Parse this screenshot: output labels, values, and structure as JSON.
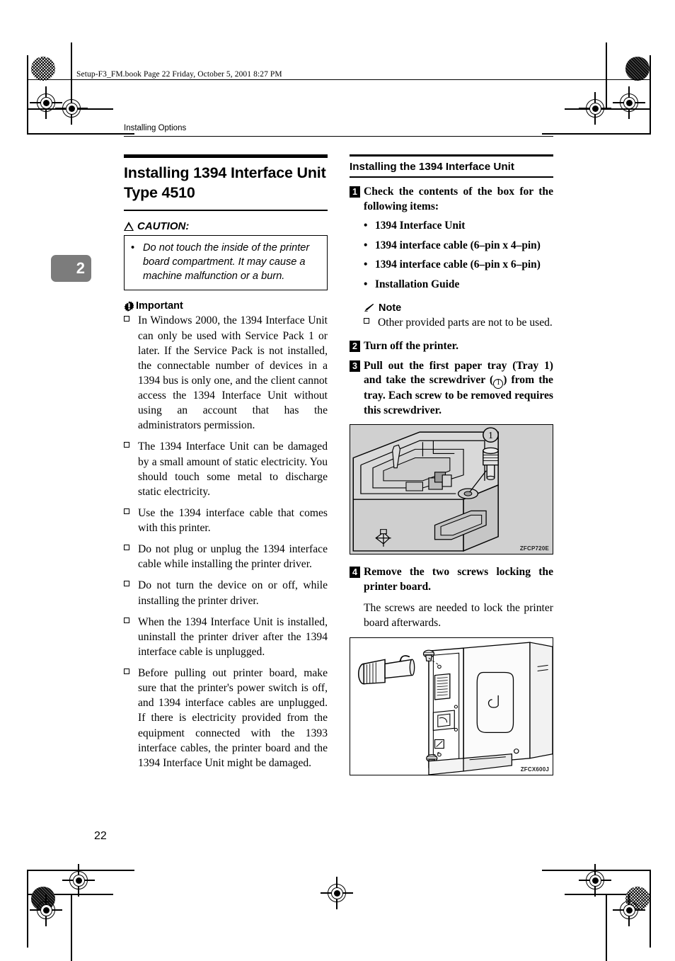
{
  "file_header": "Setup-F3_FM.book  Page 22  Friday, October 5, 2001  8:27 PM",
  "running_head": "Installing Options",
  "chapter_tab": "2",
  "page_number": "22",
  "left_column": {
    "title": "Installing 1394 Interface Unit Type 4510",
    "caution": {
      "label": "CAUTION:",
      "icon": "warning-triangle-icon",
      "items": [
        "Do not touch the inside of the printer board compartment. It may cause a machine malfunction or a burn."
      ]
    },
    "important": {
      "label": "Important",
      "icon": "important-starburst-icon",
      "items": [
        "In Windows 2000, the 1394 Interface Unit can only be used with Service Pack 1 or later. If the Service Pack is not installed, the connectable number of devices in a 1394 bus is only one, and the client cannot access the 1394 Interface Unit without using an account that has the administrators permission.",
        "The 1394 Interface Unit can be damaged by a small amount of static electricity. You should touch some metal to discharge static electricity.",
        "Use the 1394 interface cable that comes with this printer.",
        "Do not plug or unplug the 1394 interface cable while installing the printer driver.",
        "Do not turn the device on or off, while installing the printer driver.",
        "When the 1394 Interface Unit is installed, uninstall the printer driver after the 1394 interface cable is unplugged.",
        "Before pulling out printer board, make sure that the printer's power switch is off, and 1394 interface cables are unplugged. If there is electricity provided from the equipment connected with the 1393 interface cables, the printer board and the 1394 Interface Unit might be damaged."
      ]
    }
  },
  "right_column": {
    "section_title": "Installing the 1394 Interface Unit",
    "steps": [
      {
        "number": "1",
        "text": "Check the contents of the box for the following items:",
        "bullets": [
          "1394 Interface Unit",
          "1394 interface cable (6–pin x 4–pin)",
          "1394 interface cable (6–pin x 6–pin)",
          "Installation Guide"
        ],
        "note": {
          "label": "Note",
          "icon": "note-pencil-icon",
          "items": [
            "Other provided parts are not to be used."
          ]
        }
      },
      {
        "number": "2",
        "text": "Turn off the printer."
      },
      {
        "number": "3",
        "text_before": "Pull out the first paper tray (Tray 1) and take the screwdriver (",
        "callout": "1",
        "text_after": ") from the tray. Each screw to be removed requires this screwdriver.",
        "figure": {
          "code": "ZFCP720E",
          "alt": "paper-tray-screwdriver-illustration",
          "callout": "1"
        }
      },
      {
        "number": "4",
        "text": "Remove the two screws locking the printer board.",
        "plain": "The screws are needed to lock the printer board afterwards.",
        "figure": {
          "code": "ZFCX600J",
          "alt": "printer-board-screws-illustration"
        }
      }
    ]
  },
  "colors": {
    "text": "#000000",
    "chapter_tab_bg": "#7c7c7c",
    "figure_bg": "#d0d0d0"
  }
}
